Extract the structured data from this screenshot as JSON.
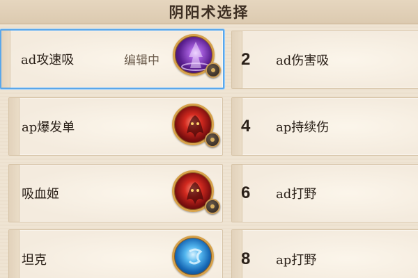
{
  "header": {
    "title": "阴阳术选择"
  },
  "left_cards": [
    {
      "name": "ad攻速吸",
      "status": "编辑中",
      "icon": "purple-spell-icon"
    },
    {
      "name": "ap爆发单",
      "icon": "red-demon-icon"
    },
    {
      "name": "吸血姬",
      "icon": "red-demon-icon"
    },
    {
      "name": "坦克",
      "icon": "blue-rune-icon"
    }
  ],
  "right_cards": [
    {
      "number": "2",
      "name": "ad伤害吸"
    },
    {
      "number": "4",
      "name": "ap持续伤"
    },
    {
      "number": "6",
      "name": "ad打野"
    },
    {
      "number": "8",
      "name": "ap打野"
    }
  ],
  "colors": {
    "selected_border": "#5aa7ea",
    "icon_ring": "#d7a24a",
    "background": "#efe3d2"
  }
}
